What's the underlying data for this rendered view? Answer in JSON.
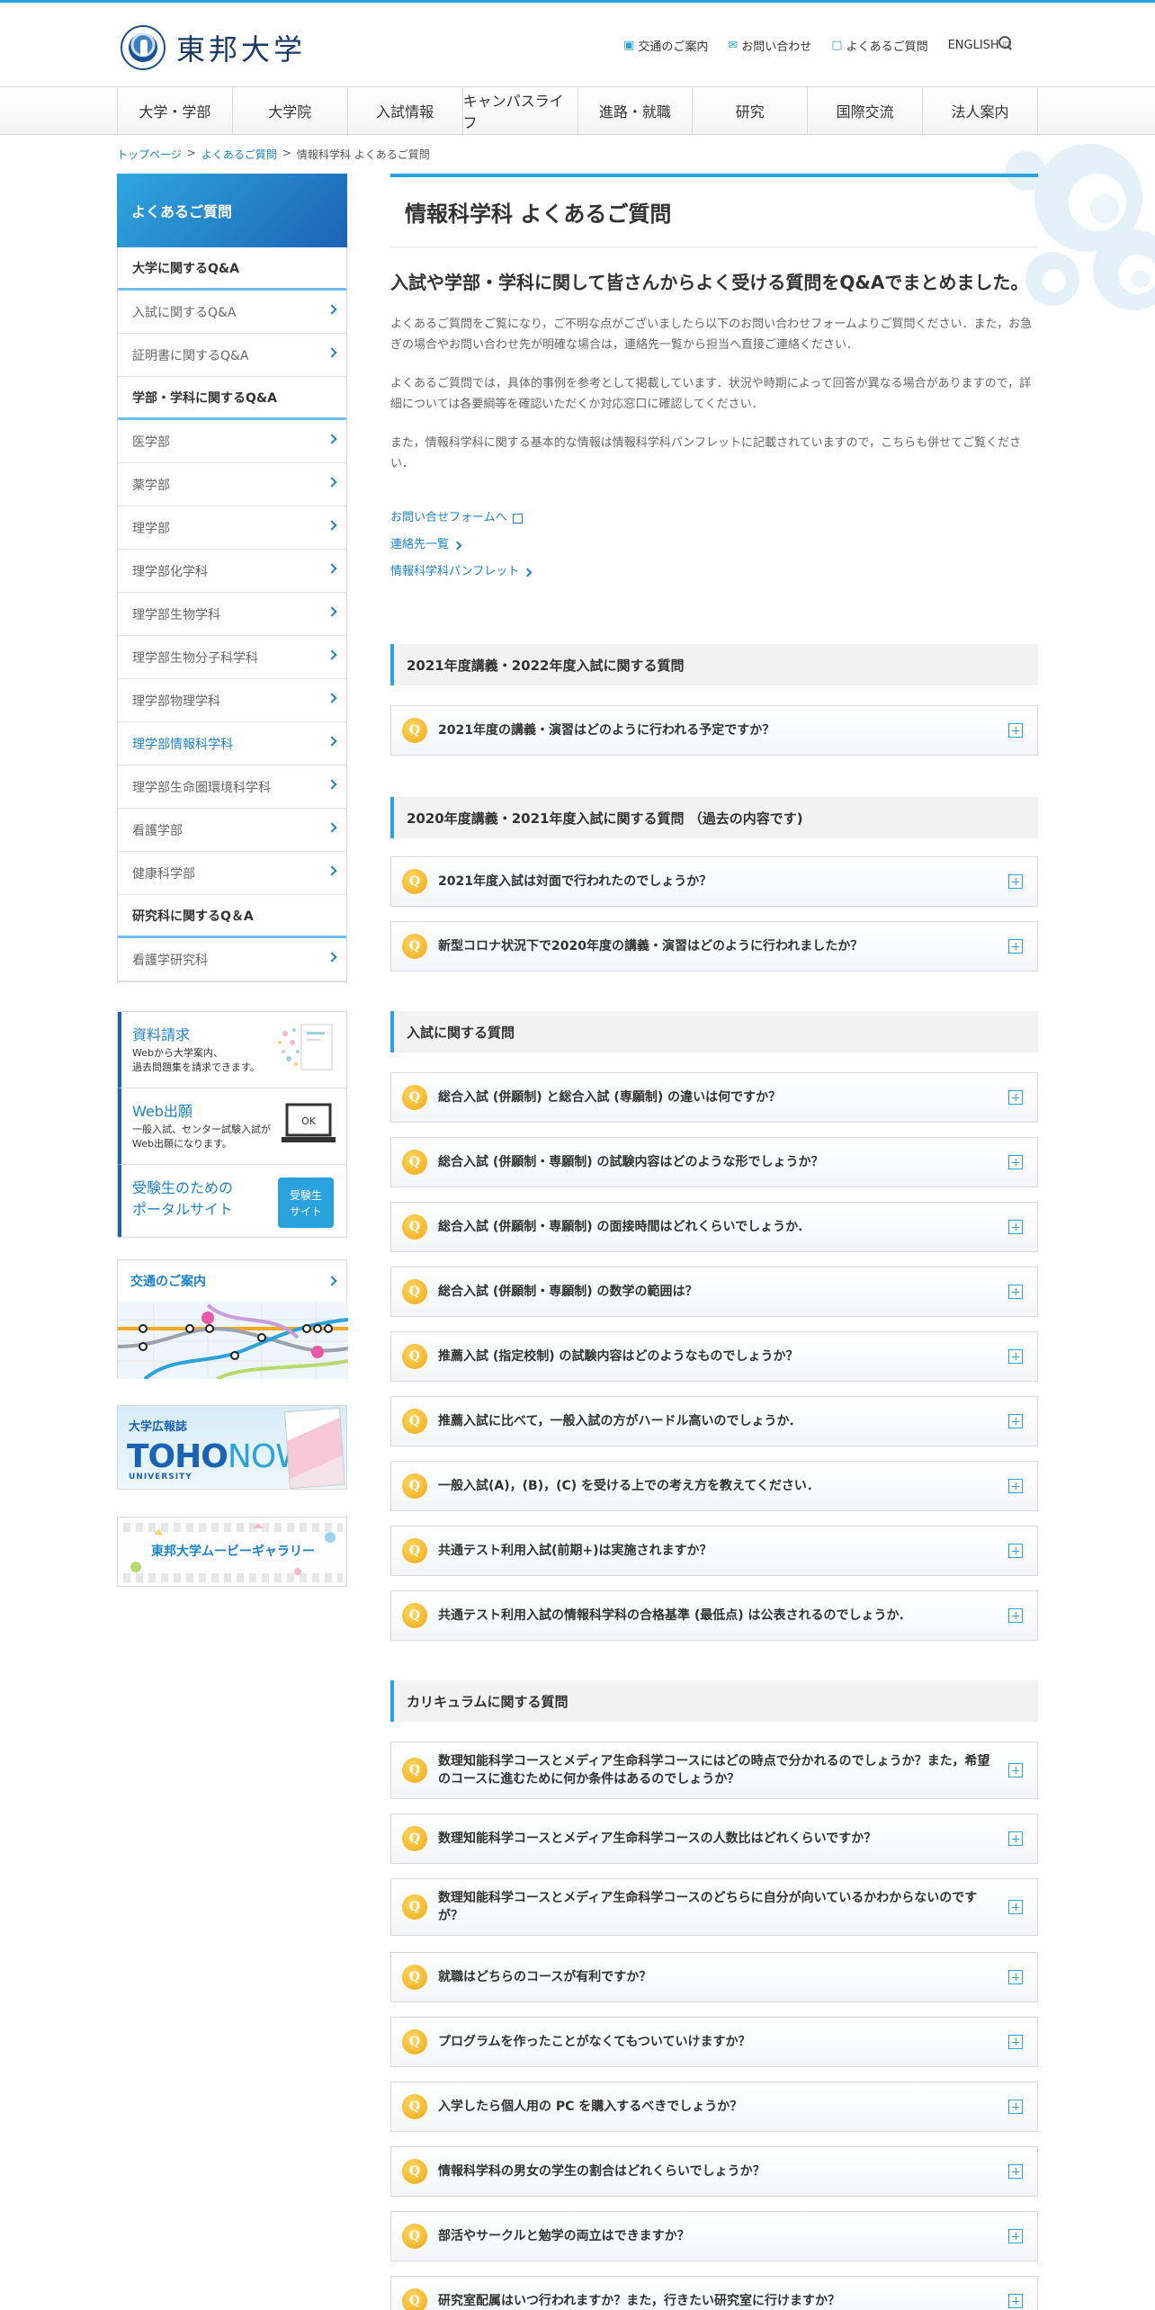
{
  "header": {
    "logo_text": "東邦大学",
    "utility": [
      "交通のご案内",
      "お問い合わせ",
      "よくあるご質問",
      "ENGLISH"
    ]
  },
  "gnav": [
    "大学・学部",
    "大学院",
    "入試情報",
    "キャンパスライフ",
    "進路・就職",
    "研究",
    "国際交流",
    "法人案内"
  ],
  "breadcrumb": [
    "トップページ",
    "よくあるご質問",
    "情報科学科 よくあるご質問"
  ],
  "sidebar": {
    "title": "よくあるご質問",
    "groups": [
      {
        "label": "大学に関するQ&A",
        "items": [
          "入試に関するQ&A",
          "証明書に関するQ&A"
        ]
      },
      {
        "label": "学部・学科に関するQ&A",
        "items": [
          "医学部",
          "薬学部",
          "理学部",
          "理学部化学科",
          "理学部生物学科",
          "理学部生物分子科学科",
          "理学部物理学科",
          "理学部情報科学科",
          "理学部生命圏環境科学科",
          "看護学部",
          "健康科学部"
        ]
      },
      {
        "label": "研究科に関するQ＆A",
        "items": [
          "看護学研究科"
        ]
      }
    ],
    "active_item": "理学部情報科学科"
  },
  "banners": {
    "request_title": "資料請求",
    "request_sub1": "Webから大学案内、",
    "request_sub2": "過去問題集を請求できます。",
    "web_title": "Web出願",
    "web_sub1": "一般入試、センター試験入試が",
    "web_sub2": "Web出願になります。",
    "web_ok": "OK",
    "portal_title1": "受験生のための",
    "portal_title2": "ポータルサイト",
    "portal_badge1": "受験生",
    "portal_badge2": "サイト",
    "access": "交通のご案内",
    "tohonow_label": "大学広報誌",
    "tohonow_logo1": "TOHO",
    "tohonow_logo2": "NOW",
    "tohonow_uni": "UNIVERSITY",
    "movie": "東邦大学ムービーギャラリー"
  },
  "main": {
    "title": "情報科学科 よくあるご質問",
    "lead": "入試や学部・学科に関して皆さんからよく受ける質問をQ&Aでまとめました。",
    "paras": [
      "よくあるご質問をご覧になり，ご不明な点がございましたら以下のお問い合わせフォームよりご質問ください．また，お急ぎの場合やお問い合わせ先が明確な場合は，連絡先一覧から担当へ直接ご連絡ください．",
      "よくあるご質問では，具体的事例を参考として掲載しています．状況や時期によって回答が異なる場合がありますので，詳細については各要綱等を確認いただくか対応窓口に確認してください．",
      "また，情報科学科に関する基本的な情報は情報科学科パンフレットに記載されていますので，こちらも併せてご覧ください．"
    ],
    "links": [
      "お問い合せフォームへ",
      "連絡先一覧",
      "情報科学科パンフレット"
    ]
  },
  "sections": [
    {
      "title": "2021年度講義・2022年度入試に関する質問",
      "questions": [
        "2021年度の講義・演習はどのように行われる予定ですか？"
      ]
    },
    {
      "title": "2020年度講義・2021年度入試に関する質問 （過去の内容です)",
      "questions": [
        "2021年度入試は対面で行われたのでしょうか？",
        "新型コロナ状況下で2020年度の講義・演習はどのように行われましたか？"
      ]
    },
    {
      "title": "入試に関する質問",
      "questions": [
        "総合入試 (併願制) と総合入試 (専願制) の違いは何ですか？",
        "総合入試 (併願制・専願制) の試験内容はどのような形でしょうか？",
        "総合入試 (併願制・専願制) の面接時間はどれくらいでしょうか．",
        "総合入試 (併願制・専願制) の数学の範囲は？",
        "推薦入試 (指定校制) の試験内容はどのようなものでしょうか？",
        "推薦入試に比べて，一般入試の方がハードル高いのでしょうか．",
        "一般入試(A)，(B)，(C) を受ける上での考え方を教えてください．",
        "共通テスト利用入試(前期+)は実施されますか？",
        "共通テスト利用入試の情報科学科の合格基準 (最低点) は公表されるのでしょうか．"
      ]
    },
    {
      "title": "カリキュラムに関する質問",
      "questions": [
        "数理知能科学コースとメディア生命科学コースにはどの時点で分かれるのでしょうか？また，希望のコースに進むために何か条件はあるのでしょうか？",
        "数理知能科学コースとメディア生命科学コースの人数比はどれくらいですか？",
        "数理知能科学コースとメディア生命科学コースのどちらに自分が向いているかわからないのですが？",
        "就職はどちらのコースが有利ですか？",
        "プログラムを作ったことがなくてもついていけますか？",
        "入学したら個人用の PC を購入するべきでしょうか？",
        "情報科学科の男女の学生の割合はどれくらいでしょうか？",
        "部活やサークルと勉学の両立はできますか？",
        "研究室配属はいつ行われますか？また，行きたい研究室に行けますか？"
      ]
    }
  ],
  "q_badge": "Q",
  "colors": {
    "accent": "#2aa2dc",
    "link": "#1e82c8",
    "badge": "#f0a70f"
  }
}
